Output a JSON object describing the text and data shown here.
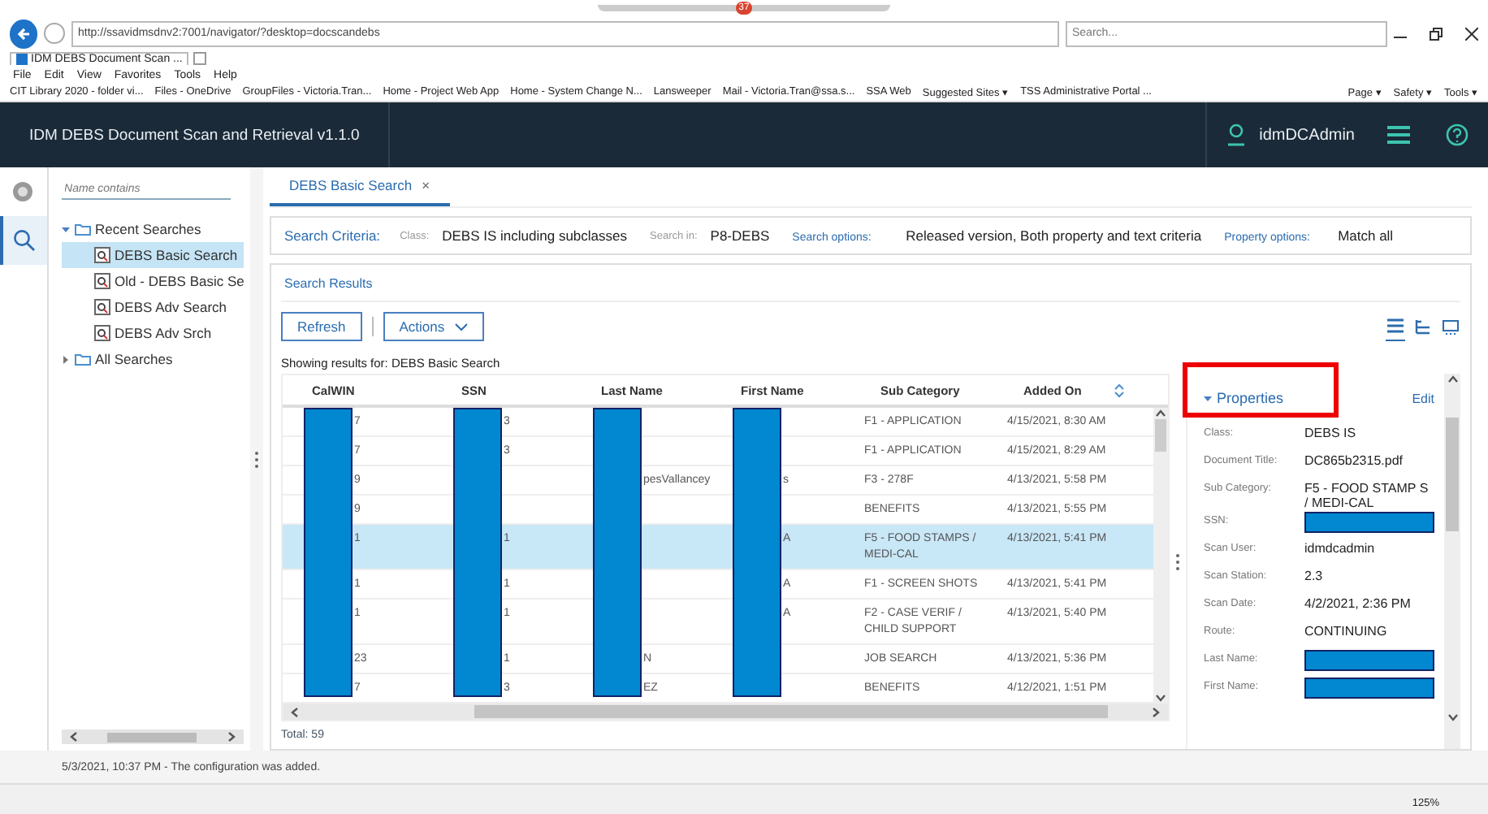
{
  "browser": {
    "tab_badge": "37",
    "address": "http://ssavidmsdnv2:7001/navigator/?desktop=docscandebs",
    "search_placeholder": "Search...",
    "tab_title": "IDM DEBS Document Scan ...",
    "menu": [
      "File",
      "Edit",
      "View",
      "Favorites",
      "Tools",
      "Help"
    ],
    "favorites": [
      "CIT Library 2020 - folder vi...",
      "Files - OneDrive",
      "GroupFiles - Victoria.Tran...",
      "Home - Project Web App",
      "Home - System Change N...",
      "Lansweeper",
      "Mail - Victoria.Tran@ssa.s...",
      "SSA Web",
      "Suggested Sites ▾",
      "TSS Administrative Portal ..."
    ],
    "commands": [
      "Page ▾",
      "Safety ▾",
      "Tools ▾"
    ],
    "zoom": "125%"
  },
  "header": {
    "title": "IDM DEBS Document Scan and Retrieval v1.1.0",
    "user": "idmDCAdmin"
  },
  "sidebar": {
    "filter_placeholder": "Name contains",
    "tree": [
      {
        "label": "Recent Searches",
        "expanded": true,
        "children": [
          {
            "label": "DEBS Basic Search",
            "selected": true
          },
          {
            "label": "Old - DEBS Basic Se",
            "selected": false
          },
          {
            "label": "DEBS Adv Search",
            "selected": false
          },
          {
            "label": "DEBS Adv Srch",
            "selected": false
          }
        ]
      },
      {
        "label": "All Searches",
        "expanded": false
      }
    ]
  },
  "tabs": [
    {
      "label": "DEBS Basic Search",
      "selected": true,
      "close": "×"
    }
  ],
  "criteria": {
    "heading": "Search Criteria:",
    "items": [
      {
        "label": "Class:",
        "value": "DEBS IS including subclasses"
      },
      {
        "label": "Search in:",
        "value": "P8-DEBS"
      },
      {
        "label": "Search options:",
        "value": "Released version, Both property and text criteria"
      },
      {
        "label": "Property options:",
        "value": "Match all"
      }
    ]
  },
  "results": {
    "heading": "Search Results",
    "refresh": "Refresh",
    "actions": "Actions",
    "views": [
      {
        "selected": true
      },
      {
        "selected": false
      },
      {
        "selected": false
      }
    ],
    "showing": "Showing results for: DEBS Basic Search"
  },
  "table": {
    "columns": [
      {
        "label": "CalWIN",
        "redacted": true
      },
      {
        "label": "SSN",
        "redacted": true
      },
      {
        "label": "Last Name",
        "redacted": true
      },
      {
        "label": "First Name",
        "redacted": true
      },
      {
        "label": "Sub Category"
      },
      {
        "label": "Added On",
        "sorted": true
      }
    ],
    "rows": [
      {
        "selected": false,
        "cells": [
          "7",
          "3",
          "",
          "",
          "F1 - APPLICATION",
          "4/15/2021, 8:30 AM"
        ]
      },
      {
        "selected": false,
        "cells": [
          "7",
          "3",
          "",
          "",
          "F1 - APPLICATION",
          "4/15/2021, 8:29 AM"
        ]
      },
      {
        "selected": false,
        "cells": [
          "9",
          "",
          "pesVallancey",
          "s",
          "F3 - 278F",
          "4/13/2021, 5:58 PM"
        ]
      },
      {
        "selected": false,
        "cells": [
          "9",
          "",
          "",
          "",
          "BENEFITS",
          "4/13/2021, 5:55 PM"
        ]
      },
      {
        "selected": true,
        "cells": [
          "1",
          "1",
          "",
          "A",
          "F5 - FOOD STAMPS / MEDI-CAL",
          "4/13/2021, 5:41 PM"
        ]
      },
      {
        "selected": false,
        "cells": [
          "1",
          "1",
          "",
          "A",
          "F1 - SCREEN SHOTS",
          "4/13/2021, 5:41 PM"
        ]
      },
      {
        "selected": false,
        "cells": [
          "1",
          "1",
          "",
          "A",
          "F2 - CASE VERIF / CHILD SUPPORT",
          "4/13/2021, 5:40 PM"
        ]
      },
      {
        "selected": false,
        "cells": [
          "23",
          "1",
          "N",
          "",
          "JOB SEARCH",
          "4/13/2021, 5:36 PM"
        ]
      },
      {
        "selected": false,
        "cells": [
          "7",
          "3",
          "EZ",
          "",
          "BENEFITS",
          "4/12/2021, 1:51 PM"
        ]
      }
    ],
    "total": "Total: 59"
  },
  "properties": {
    "heading": "Properties",
    "expanded": true,
    "edit": "Edit",
    "rows": [
      {
        "label": "Class:",
        "value": "DEBS IS"
      },
      {
        "label": "Document Title:",
        "value": "DC865b2315.pdf"
      },
      {
        "label": "Sub Category:",
        "value": "F5 - FOOD STAMP S / MEDI-CAL"
      },
      {
        "label": "SSN:",
        "redacted": true
      },
      {
        "label": "Scan User:",
        "value": "idmdcadmin"
      },
      {
        "label": "Scan Station:",
        "value": "2.3"
      },
      {
        "label": "Scan Date:",
        "value": "4/2/2021, 2:36 PM"
      },
      {
        "label": "Route:",
        "value": "CONTINUING"
      },
      {
        "label": "Last Name:",
        "redacted": true
      },
      {
        "label": "First Name:",
        "redacted": true
      }
    ]
  },
  "status": "5/3/2021, 10:37 PM - The configuration was added."
}
